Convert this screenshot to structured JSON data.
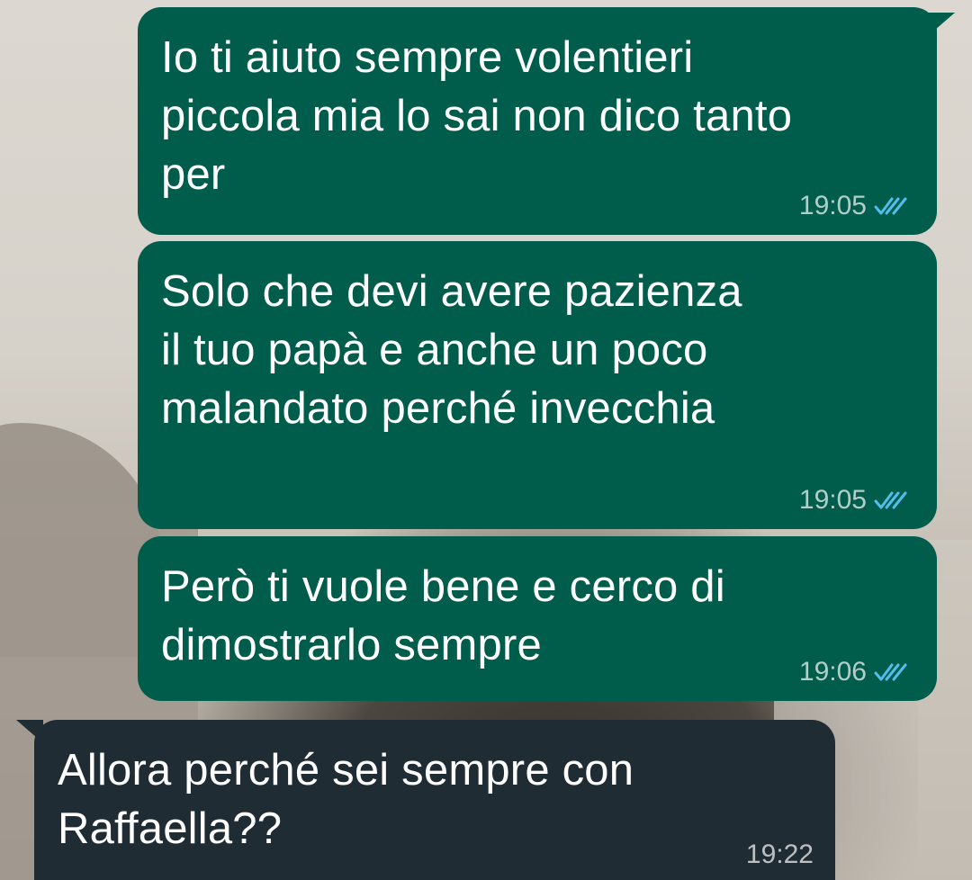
{
  "colors": {
    "outgoing_bubble": "#005c4b",
    "incoming_bubble": "#202c33",
    "read_ticks": "#53bdeb",
    "timestamp": "#c8d6d2"
  },
  "messages": [
    {
      "direction": "outgoing",
      "text": "Io ti aiuto sempre volentieri\npiccola mia lo sai non dico tanto\nper",
      "time": "19:05",
      "status_icon": "double-check-read-icon"
    },
    {
      "direction": "outgoing",
      "text": "Solo che devi avere pazienza\nil tuo papà e anche un poco\nmalandato perché invecchia",
      "time": "19:05",
      "status_icon": "double-check-read-icon"
    },
    {
      "direction": "outgoing",
      "text": "Però ti vuole bene e cerco di\ndimostrarlo sempre",
      "time": "19:06",
      "status_icon": "double-check-read-icon"
    },
    {
      "direction": "incoming",
      "text": "Allora perché sei sempre con\nRaffaella??",
      "time": "19:22"
    }
  ]
}
